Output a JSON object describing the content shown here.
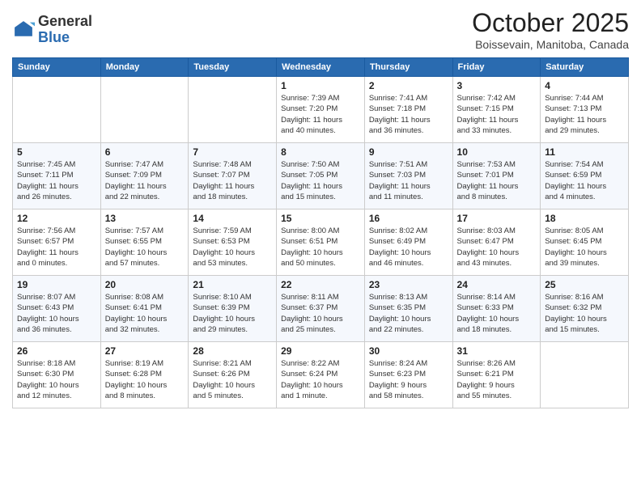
{
  "logo": {
    "general": "General",
    "blue": "Blue"
  },
  "title": "October 2025",
  "location": "Boissevain, Manitoba, Canada",
  "days_of_week": [
    "Sunday",
    "Monday",
    "Tuesday",
    "Wednesday",
    "Thursday",
    "Friday",
    "Saturday"
  ],
  "weeks": [
    [
      {
        "day": "",
        "info": ""
      },
      {
        "day": "",
        "info": ""
      },
      {
        "day": "",
        "info": ""
      },
      {
        "day": "1",
        "info": "Sunrise: 7:39 AM\nSunset: 7:20 PM\nDaylight: 11 hours\nand 40 minutes."
      },
      {
        "day": "2",
        "info": "Sunrise: 7:41 AM\nSunset: 7:18 PM\nDaylight: 11 hours\nand 36 minutes."
      },
      {
        "day": "3",
        "info": "Sunrise: 7:42 AM\nSunset: 7:15 PM\nDaylight: 11 hours\nand 33 minutes."
      },
      {
        "day": "4",
        "info": "Sunrise: 7:44 AM\nSunset: 7:13 PM\nDaylight: 11 hours\nand 29 minutes."
      }
    ],
    [
      {
        "day": "5",
        "info": "Sunrise: 7:45 AM\nSunset: 7:11 PM\nDaylight: 11 hours\nand 26 minutes."
      },
      {
        "day": "6",
        "info": "Sunrise: 7:47 AM\nSunset: 7:09 PM\nDaylight: 11 hours\nand 22 minutes."
      },
      {
        "day": "7",
        "info": "Sunrise: 7:48 AM\nSunset: 7:07 PM\nDaylight: 11 hours\nand 18 minutes."
      },
      {
        "day": "8",
        "info": "Sunrise: 7:50 AM\nSunset: 7:05 PM\nDaylight: 11 hours\nand 15 minutes."
      },
      {
        "day": "9",
        "info": "Sunrise: 7:51 AM\nSunset: 7:03 PM\nDaylight: 11 hours\nand 11 minutes."
      },
      {
        "day": "10",
        "info": "Sunrise: 7:53 AM\nSunset: 7:01 PM\nDaylight: 11 hours\nand 8 minutes."
      },
      {
        "day": "11",
        "info": "Sunrise: 7:54 AM\nSunset: 6:59 PM\nDaylight: 11 hours\nand 4 minutes."
      }
    ],
    [
      {
        "day": "12",
        "info": "Sunrise: 7:56 AM\nSunset: 6:57 PM\nDaylight: 11 hours\nand 0 minutes."
      },
      {
        "day": "13",
        "info": "Sunrise: 7:57 AM\nSunset: 6:55 PM\nDaylight: 10 hours\nand 57 minutes."
      },
      {
        "day": "14",
        "info": "Sunrise: 7:59 AM\nSunset: 6:53 PM\nDaylight: 10 hours\nand 53 minutes."
      },
      {
        "day": "15",
        "info": "Sunrise: 8:00 AM\nSunset: 6:51 PM\nDaylight: 10 hours\nand 50 minutes."
      },
      {
        "day": "16",
        "info": "Sunrise: 8:02 AM\nSunset: 6:49 PM\nDaylight: 10 hours\nand 46 minutes."
      },
      {
        "day": "17",
        "info": "Sunrise: 8:03 AM\nSunset: 6:47 PM\nDaylight: 10 hours\nand 43 minutes."
      },
      {
        "day": "18",
        "info": "Sunrise: 8:05 AM\nSunset: 6:45 PM\nDaylight: 10 hours\nand 39 minutes."
      }
    ],
    [
      {
        "day": "19",
        "info": "Sunrise: 8:07 AM\nSunset: 6:43 PM\nDaylight: 10 hours\nand 36 minutes."
      },
      {
        "day": "20",
        "info": "Sunrise: 8:08 AM\nSunset: 6:41 PM\nDaylight: 10 hours\nand 32 minutes."
      },
      {
        "day": "21",
        "info": "Sunrise: 8:10 AM\nSunset: 6:39 PM\nDaylight: 10 hours\nand 29 minutes."
      },
      {
        "day": "22",
        "info": "Sunrise: 8:11 AM\nSunset: 6:37 PM\nDaylight: 10 hours\nand 25 minutes."
      },
      {
        "day": "23",
        "info": "Sunrise: 8:13 AM\nSunset: 6:35 PM\nDaylight: 10 hours\nand 22 minutes."
      },
      {
        "day": "24",
        "info": "Sunrise: 8:14 AM\nSunset: 6:33 PM\nDaylight: 10 hours\nand 18 minutes."
      },
      {
        "day": "25",
        "info": "Sunrise: 8:16 AM\nSunset: 6:32 PM\nDaylight: 10 hours\nand 15 minutes."
      }
    ],
    [
      {
        "day": "26",
        "info": "Sunrise: 8:18 AM\nSunset: 6:30 PM\nDaylight: 10 hours\nand 12 minutes."
      },
      {
        "day": "27",
        "info": "Sunrise: 8:19 AM\nSunset: 6:28 PM\nDaylight: 10 hours\nand 8 minutes."
      },
      {
        "day": "28",
        "info": "Sunrise: 8:21 AM\nSunset: 6:26 PM\nDaylight: 10 hours\nand 5 minutes."
      },
      {
        "day": "29",
        "info": "Sunrise: 8:22 AM\nSunset: 6:24 PM\nDaylight: 10 hours\nand 1 minute."
      },
      {
        "day": "30",
        "info": "Sunrise: 8:24 AM\nSunset: 6:23 PM\nDaylight: 9 hours\nand 58 minutes."
      },
      {
        "day": "31",
        "info": "Sunrise: 8:26 AM\nSunset: 6:21 PM\nDaylight: 9 hours\nand 55 minutes."
      },
      {
        "day": "",
        "info": ""
      }
    ]
  ]
}
